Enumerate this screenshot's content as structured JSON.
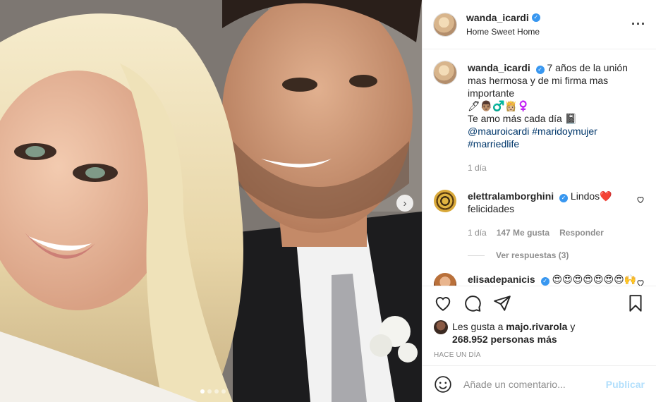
{
  "post": {
    "username": "wanda_icardi",
    "location": "Home Sweet Home",
    "verified_icon": "verified-badge-icon",
    "more_icon": "more-options-icon",
    "carousel": {
      "dots": 4,
      "active_index": 0,
      "next_icon": "chevron-right-icon"
    }
  },
  "caption": {
    "username": "wanda_icardi",
    "text_line1": "7 años de la unión mas hermosa y de mi firma mas importante",
    "emojis": "🖊👨🏽‍♂️👸🏼‍♀️",
    "text_line2": "Te amo más cada día 📓",
    "mention": "@mauroicardi",
    "hashtag1": "#maridoymujer",
    "hashtag2": "#marriedlife",
    "time": "1 día"
  },
  "comments": [
    {
      "username": "elettralamborghini",
      "text": "Lindos❤️ felicidades",
      "time": "1 día",
      "likes": "147 Me gusta",
      "reply": "Responder",
      "view_replies": "Ver respuestas (3)"
    },
    {
      "username": "elisadepanicis",
      "text": "😍😍😍😍😍😍😍🙌 ❤️❤️❤️❤️"
    }
  ],
  "likes": {
    "prefix": "Les gusta a",
    "user": "majo.rivarola",
    "connector": "y",
    "count": "268.952 personas más"
  },
  "timestamp": "HACE UN DÍA",
  "add_comment": {
    "emoji_icon": "smiley-icon",
    "placeholder": "Añade un comentario...",
    "publish": "Publicar"
  },
  "colors": {
    "link": "#00376b",
    "verified": "#3897f0",
    "publish_disabled": "#b2dffc",
    "muted": "#8e8e8e"
  }
}
